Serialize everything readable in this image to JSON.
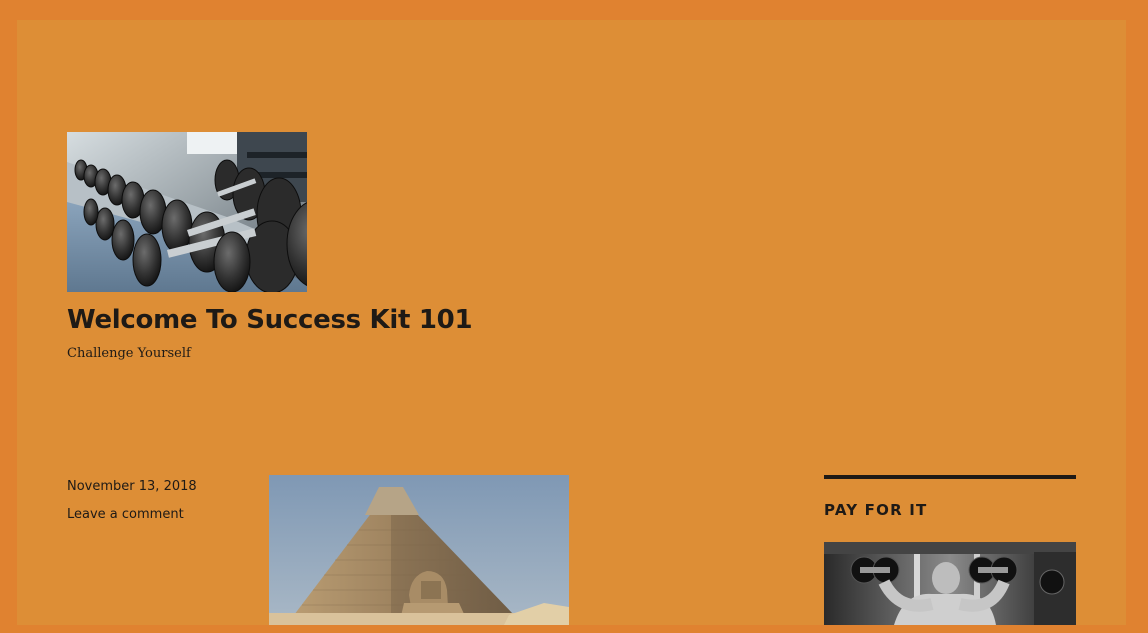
{
  "colors": {
    "outer_border": "#e08230",
    "page_background": "#dd8e36",
    "text": "#1e1a16"
  },
  "header": {
    "logo_image": "dumbbell-rack-photo",
    "title": "Welcome To Success Kit 101",
    "tagline": "Challenge Yourself"
  },
  "post": {
    "date": "November 13, 2018",
    "comment_link": "Leave a comment",
    "featured_image": "pyramid-and-sphinx-photo"
  },
  "sidebar": {
    "widget_title": "PAY FOR IT",
    "widget_image": "bodybuilder-dumbbell-press-photo"
  }
}
